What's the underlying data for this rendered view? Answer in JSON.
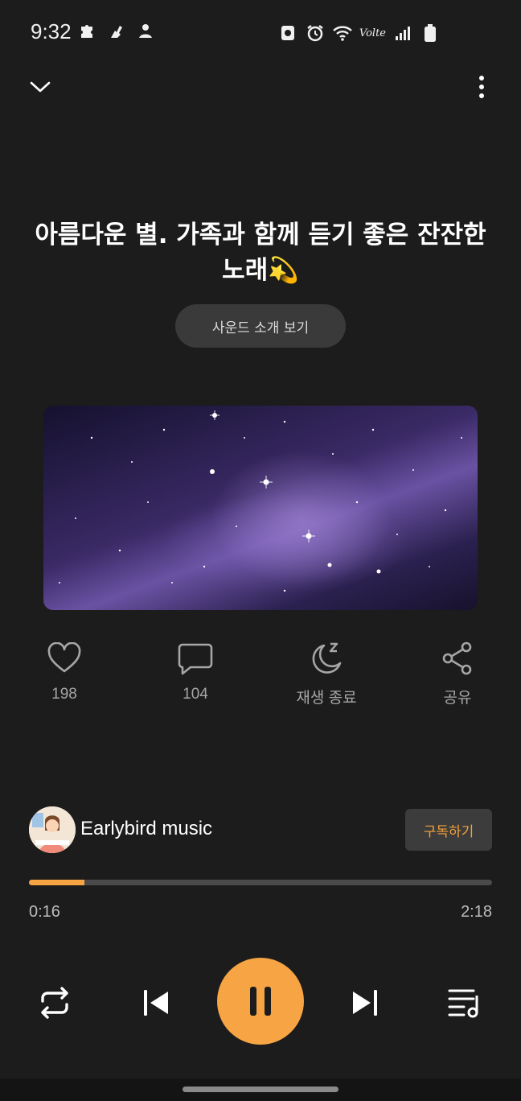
{
  "status_bar": {
    "time": "9:32",
    "left_icons": [
      "puzzle-icon",
      "bird-notification-icon",
      "leaf-notification-icon"
    ],
    "right_icons": [
      "recycle-icon",
      "alarm-icon",
      "wifi-icon",
      "volte-icon",
      "signal-icon",
      "battery-icon"
    ],
    "volte_label": "Volte"
  },
  "top_nav": {
    "collapse_icon": "chevron-down-icon",
    "more_icon": "more-vertical-icon"
  },
  "track": {
    "title": "아름다운 별. 가족과 함께 듣기 좋은 잔잔한 노래💫",
    "intro_button": "사운드 소개 보기"
  },
  "actions": {
    "like_count": "198",
    "comment_count": "104",
    "sleep_timer_label": "재생 종료",
    "share_label": "공유"
  },
  "channel": {
    "name": "Earlybird music",
    "subscribe_label": "구독하기"
  },
  "player": {
    "current_time": "0:16",
    "total_time": "2:18",
    "progress": 0.12,
    "state": "playing"
  },
  "colors": {
    "accent": "#f7a444",
    "background": "#1c1c1c",
    "muted_text": "#a6a6a6"
  }
}
